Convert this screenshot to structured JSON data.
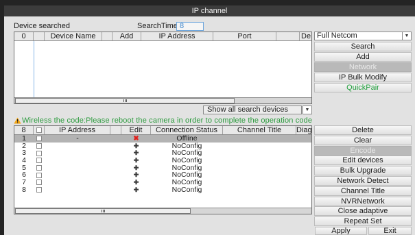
{
  "window": {
    "title": "IP channel"
  },
  "search": {
    "device_searched_label": "Device searched",
    "search_time_label": "SearchTime",
    "search_time_value": "8"
  },
  "search_table": {
    "headers": {
      "index": "0",
      "device_name": "Device Name",
      "add": "Add",
      "ip_address": "IP Address",
      "port": "Port",
      "truncated": "De"
    },
    "rows": []
  },
  "protocol_select": {
    "selected": "Full Netcom",
    "icon": "chevron-down-icon"
  },
  "search_actions": [
    {
      "label": "Search",
      "disabled": false
    },
    {
      "label": "Add",
      "disabled": false
    },
    {
      "label": "Network",
      "disabled": true
    },
    {
      "label": "IP Bulk Modify",
      "disabled": false
    },
    {
      "label": "QuickPair",
      "disabled": false,
      "text_color": "#1f9e3b"
    }
  ],
  "device_filter_select": {
    "selected": "Show all search devices",
    "icon": "chevron-down-icon"
  },
  "warning": {
    "icon": "warning-icon",
    "text": "Wireless the code:Please reboot the camera in order to complete the operation code",
    "color": "#2a9a3c"
  },
  "channel_table": {
    "headers": {
      "channel_count": "8",
      "ip_address": "IP Address",
      "edit": "Edit",
      "connection_status": "Connection Status",
      "channel_title": "Channel Title",
      "diag": "Diag"
    },
    "rows": [
      {
        "channel": "1",
        "checked": false,
        "ip_address": "-",
        "edit_icon": "delete-icon",
        "connection_status": "Offline",
        "channel_title": "",
        "selected": true
      },
      {
        "channel": "2",
        "checked": false,
        "ip_address": "",
        "edit_icon": "add-icon",
        "connection_status": "NoConfig",
        "channel_title": "",
        "selected": false
      },
      {
        "channel": "3",
        "checked": false,
        "ip_address": "",
        "edit_icon": "add-icon",
        "connection_status": "NoConfig",
        "channel_title": "",
        "selected": false
      },
      {
        "channel": "4",
        "checked": false,
        "ip_address": "",
        "edit_icon": "add-icon",
        "connection_status": "NoConfig",
        "channel_title": "",
        "selected": false
      },
      {
        "channel": "5",
        "checked": false,
        "ip_address": "",
        "edit_icon": "add-icon",
        "connection_status": "NoConfig",
        "channel_title": "",
        "selected": false
      },
      {
        "channel": "6",
        "checked": false,
        "ip_address": "",
        "edit_icon": "add-icon",
        "connection_status": "NoConfig",
        "channel_title": "",
        "selected": false
      },
      {
        "channel": "7",
        "checked": false,
        "ip_address": "",
        "edit_icon": "add-icon",
        "connection_status": "NoConfig",
        "channel_title": "",
        "selected": false
      },
      {
        "channel": "8",
        "checked": false,
        "ip_address": "",
        "edit_icon": "add-icon",
        "connection_status": "NoConfig",
        "channel_title": "",
        "selected": false
      }
    ]
  },
  "channel_actions": [
    {
      "label": "Delete",
      "disabled": false
    },
    {
      "label": "Clear",
      "disabled": false
    },
    {
      "label": "Encode",
      "disabled": true
    },
    {
      "label": "Edit devices",
      "disabled": false
    },
    {
      "label": "Bulk Upgrade",
      "disabled": false
    },
    {
      "label": "Network Detect",
      "disabled": false
    },
    {
      "label": "Channel Title",
      "disabled": false
    },
    {
      "label": "NVRNetwork",
      "disabled": false
    },
    {
      "label": "Close adaptive",
      "disabled": false
    },
    {
      "label": "Repeat Set",
      "disabled": false
    }
  ],
  "footer": {
    "apply": "Apply",
    "exit": "Exit"
  },
  "colors": {
    "title_bar": "#3c3c3c",
    "delete_icon": "#e0201c",
    "warning_icon": "#f2a516",
    "selected_row": "#b3b3b3",
    "search_time_border": "#6ea6dc"
  }
}
